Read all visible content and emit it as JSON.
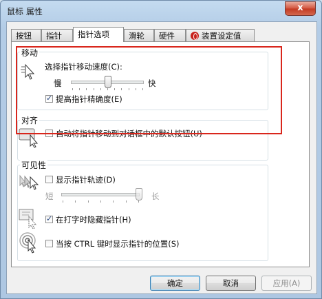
{
  "window": {
    "title": "鼠标 属性",
    "close_glyph": "x"
  },
  "tabs": [
    {
      "label": "按钮"
    },
    {
      "label": "指针"
    },
    {
      "label": "指针选项"
    },
    {
      "label": "滑轮"
    },
    {
      "label": "硬件"
    },
    {
      "label": "装置设定值"
    }
  ],
  "motion": {
    "title": "移动",
    "speed_label": "选择指针移动速度(C):",
    "slow": "慢",
    "fast": "快",
    "speed_value": 0.5,
    "precision_label": "提高指针精确度(E)",
    "precision_checked": true
  },
  "snap": {
    "title": "对齐",
    "label": "自动将指针移动到对话框中的默认按钮(U)",
    "checked": false
  },
  "visibility": {
    "title": "可见性",
    "trails_label": "显示指针轨迹(D)",
    "trails_checked": false,
    "short": "短",
    "long": "长",
    "trails_value": 1.0,
    "hide_label": "在打字时隐藏指针(H)",
    "hide_checked": true,
    "ctrl_label": "当按 CTRL 键时显示指针的位置(S)",
    "ctrl_checked": false
  },
  "buttons": {
    "ok": "确定",
    "cancel": "取消",
    "apply": "应用(A)"
  },
  "colors": {
    "highlight": "#d9261c",
    "accent": "#3c7fb1"
  }
}
